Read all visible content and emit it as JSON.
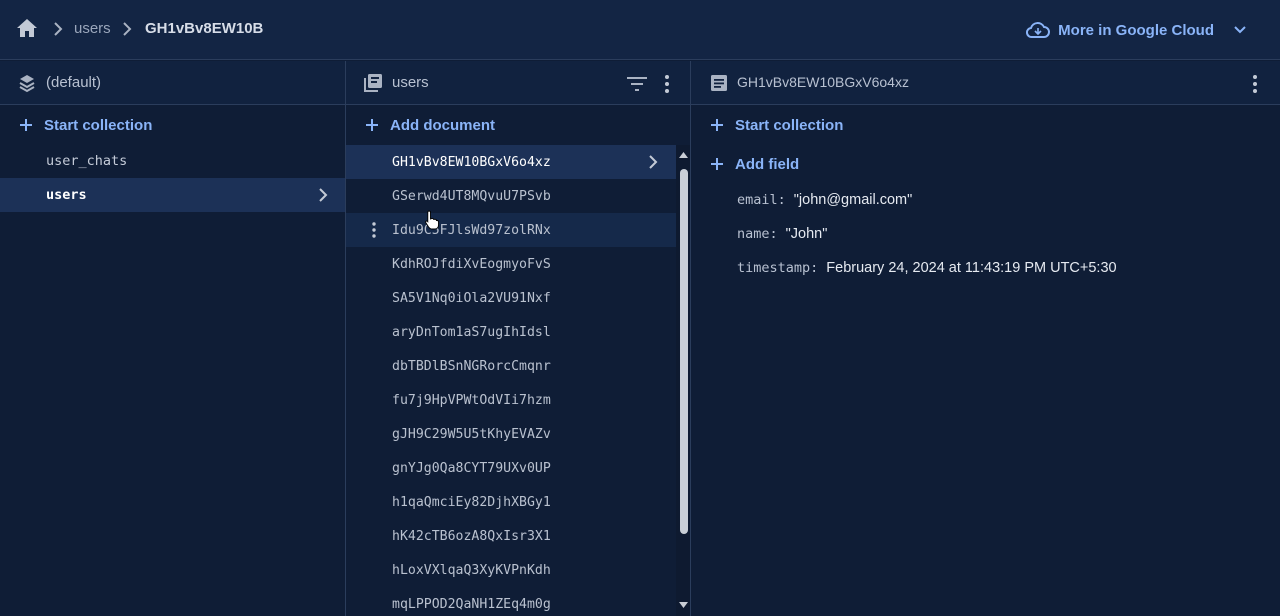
{
  "breadcrumb": {
    "items": [
      "users",
      "GH1vBv8EW10B"
    ]
  },
  "header": {
    "more_label": "More in Google Cloud"
  },
  "root_panel": {
    "title": "(default)",
    "action_label": "Start collection",
    "collections": [
      "user_chats",
      "users"
    ],
    "selected": "users"
  },
  "collection_panel": {
    "title": "users",
    "action_label": "Add document",
    "documents": [
      "GH1vBv8EW10BGxV6o4xz",
      "GSerwd4UT8MQvuU7PSvb",
      "Idu9C5FJlsWd97zolRNx",
      "KdhROJfdiXvEogmyoFvS",
      "SA5V1Nq0iOla2VU91Nxf",
      "aryDnTom1aS7ugIhIdsl",
      "dbTBDlBSnNGRorcCmqnr",
      "fu7j9HpVPWtOdVIi7hzm",
      "gJH9C29W5U5tKhyEVAZv",
      "gnYJg0Qa8CYT79UXv0UP",
      "h1qaQmciEy82DjhXBGy1",
      "hK42cTB6ozA8QxIsr3X1",
      "hLoxVXlqaQ3XyKVPnKdh",
      "mqLPPOD2QaNH1ZEq4m0g"
    ]
  },
  "document_panel": {
    "title": "GH1vBv8EW10BGxV6o4xz",
    "start_collection_label": "Start collection",
    "add_field_label": "Add field",
    "fields": [
      {
        "key": "email:",
        "value": "\"john@gmail.com\""
      },
      {
        "key": "name:",
        "value": "\"John\""
      },
      {
        "key": "timestamp:",
        "value": "February 24, 2024 at 11:43:19 PM UTC+5:30"
      }
    ]
  },
  "colors": {
    "background": "#0f1d36",
    "accent": "#8ab4f8",
    "selected_row": "#1c3157"
  },
  "icons": [
    "home-icon",
    "cloud-icon",
    "chevron-down-icon",
    "stack-icon",
    "collection-icon",
    "document-icon",
    "filter-icon",
    "kebab-icon",
    "plus-icon",
    "chevron-right-icon"
  ]
}
